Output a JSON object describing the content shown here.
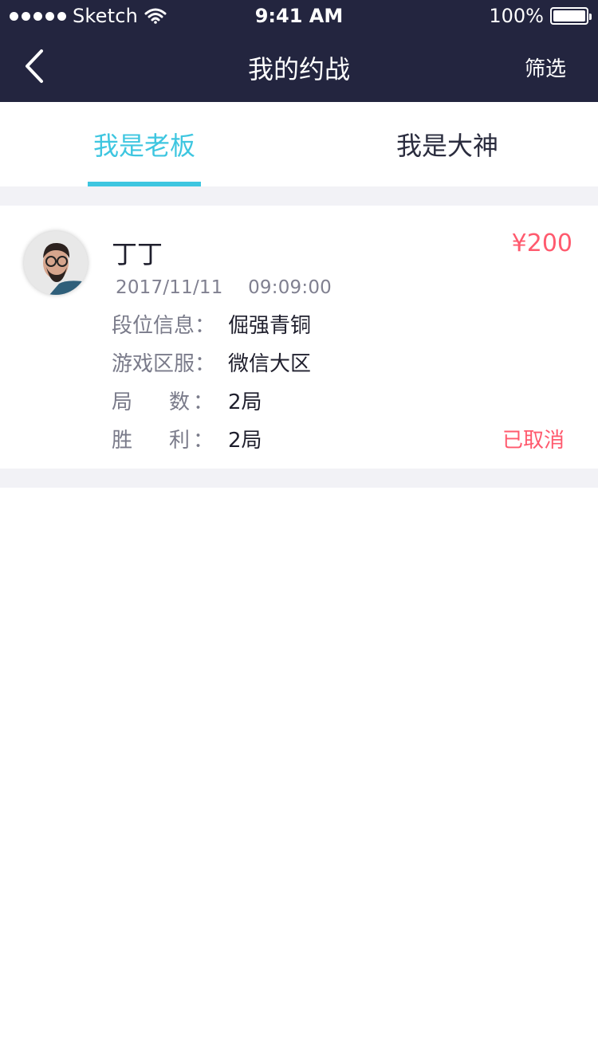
{
  "status_bar": {
    "carrier": "Sketch",
    "time": "9:41 AM",
    "battery": "100%",
    "battery_level": 1.0
  },
  "nav": {
    "title": "我的约战",
    "right_action": "筛选",
    "back_icon": "chevron-left-icon"
  },
  "tabs": [
    {
      "label": "我是老板",
      "active": true
    },
    {
      "label": "我是大神",
      "active": false
    }
  ],
  "colors": {
    "header_bg": "#23253f",
    "accent": "#3ec6e0",
    "price": "#ff5a6e",
    "canceled": "#ff5a6e",
    "page_bg": "#f2f2f6"
  },
  "order": {
    "name": "丁丁",
    "price": "¥200",
    "date": "2017/11/11",
    "time": "09:09:00",
    "fields": [
      {
        "label": "段位信息：",
        "value": "倔强青铜"
      },
      {
        "label": "游戏区服：",
        "value": "微信大区"
      },
      {
        "label_a": "局",
        "label_b": "数",
        "label_colon": "：",
        "value": "2局"
      },
      {
        "label_a": "胜",
        "label_b": "利",
        "label_colon": "：",
        "value": "2局"
      }
    ],
    "status": "已取消"
  }
}
